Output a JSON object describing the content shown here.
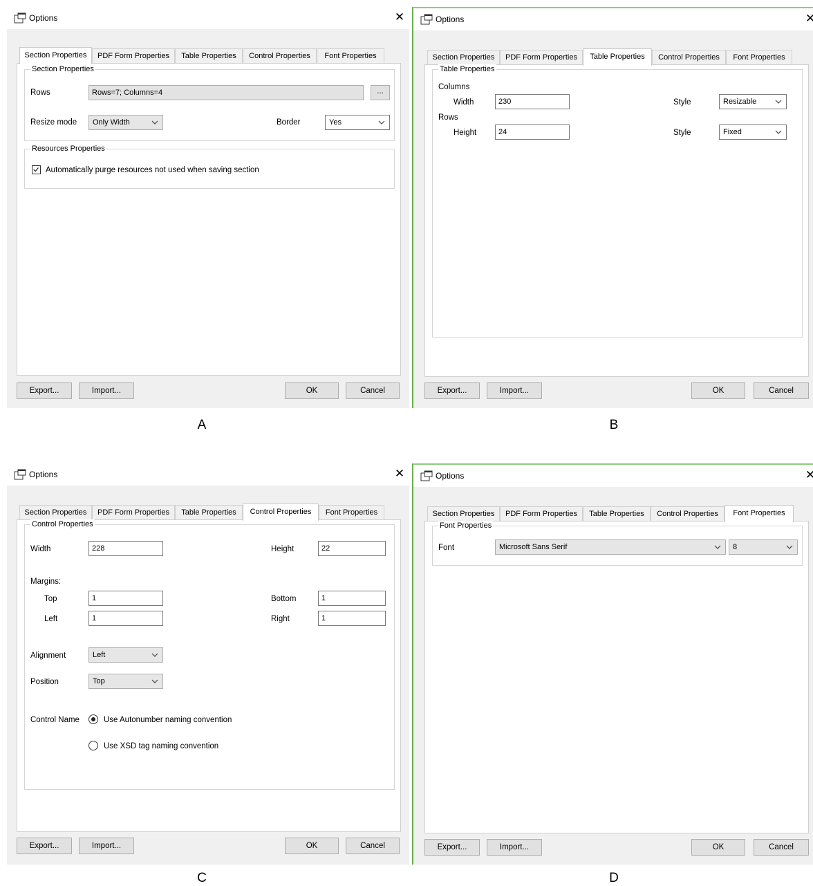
{
  "window_title": "Options",
  "tabs": [
    "Section Properties",
    "PDF Form Properties",
    "Table Properties",
    "Control Properties",
    "Font Properties"
  ],
  "buttons": {
    "export": "Export...",
    "import": "Import...",
    "ok": "OK",
    "cancel": "Cancel",
    "browse": "..."
  },
  "panel_captions": {
    "a": "A",
    "b": "B",
    "c": "C",
    "d": "D"
  },
  "panel_a": {
    "active_tab": "Section Properties",
    "section_group_title": "Section Properties",
    "rows_label": "Rows",
    "rows_value": "Rows=7; Columns=4",
    "resize_mode_label": "Resize mode",
    "resize_mode_value": "Only Width",
    "border_label": "Border",
    "border_value": "Yes",
    "resources_group_title": "Resources Properties",
    "purge_checkbox_label": "Automatically purge resources not used when saving section",
    "purge_checked": true
  },
  "panel_b": {
    "active_tab": "Table Properties",
    "group_title": "Table Properties",
    "columns_label": "Columns",
    "width_label": "Width",
    "width_value": "230",
    "col_style_label": "Style",
    "col_style_value": "Resizable",
    "rows_label": "Rows",
    "height_label": "Height",
    "height_value": "24",
    "row_style_label": "Style",
    "row_style_value": "Fixed"
  },
  "panel_c": {
    "active_tab": "Control Properties",
    "group_title": "Control Properties",
    "width_label": "Width",
    "width_value": "228",
    "height_label": "Height",
    "height_value": "22",
    "margins_label": "Margins:",
    "top_label": "Top",
    "top_value": "1",
    "bottom_label": "Bottom",
    "bottom_value": "1",
    "left_label": "Left",
    "left_value": "1",
    "right_label": "Right",
    "right_value": "1",
    "alignment_label": "Alignment",
    "alignment_value": "Left",
    "position_label": "Position",
    "position_value": "Top",
    "control_name_label": "Control Name",
    "radio_autonumber_label": "Use Autonumber naming convention",
    "radio_xsd_label": "Use XSD tag naming convention",
    "selected_radio": "autonumber"
  },
  "panel_d": {
    "active_tab": "Font Properties",
    "group_title": "Font Properties",
    "font_label": "Font",
    "font_value": "Microsoft Sans Serif",
    "size_value": "8"
  },
  "icons": {
    "window": "options-window-icon",
    "close": "close-icon",
    "dropdown": "chevron-down-icon",
    "checkbox": "checkmark-icon"
  },
  "colors": {
    "window_border_accent": "#6ab04c",
    "dialog_bg": "#f0f0f0",
    "page_bg": "#ffffff",
    "button_bg": "#e1e1e1"
  }
}
